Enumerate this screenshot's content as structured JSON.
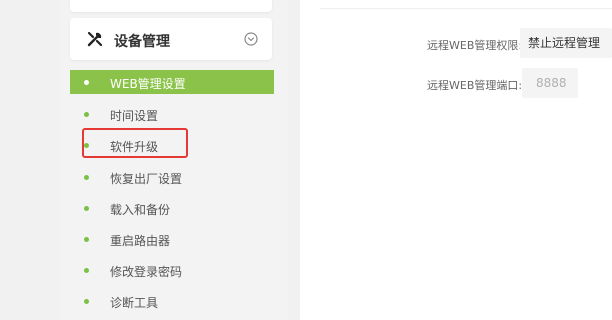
{
  "sidebar": {
    "section_title": "设备管理",
    "section_icon": "tools-icon",
    "collapse_icon": "chevron-circle-icon",
    "items": [
      {
        "label": "WEB管理设置",
        "active": true
      },
      {
        "label": "时间设置",
        "active": false
      },
      {
        "label": "软件升级",
        "active": false,
        "highlighted": true
      },
      {
        "label": "恢复出厂设置",
        "active": false
      },
      {
        "label": "载入和备份",
        "active": false
      },
      {
        "label": "重启路由器",
        "active": false
      },
      {
        "label": "修改登录密码",
        "active": false
      },
      {
        "label": "诊断工具",
        "active": false
      }
    ]
  },
  "main": {
    "remote_permission": {
      "label": "远程WEB管理权限:",
      "value": "禁止远程管理"
    },
    "remote_port": {
      "label": "远程WEB管理端口:",
      "placeholder": "8888"
    }
  },
  "colors": {
    "accent_green": "#8bc34a",
    "highlight_red": "#e53935"
  }
}
